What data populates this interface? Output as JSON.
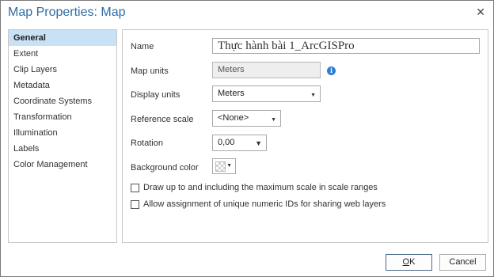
{
  "dialog": {
    "title": "Map Properties: Map",
    "close_glyph": "✕"
  },
  "nav": {
    "items": [
      {
        "label": "General",
        "selected": true
      },
      {
        "label": "Extent"
      },
      {
        "label": "Clip Layers"
      },
      {
        "label": "Metadata"
      },
      {
        "label": "Coordinate Systems"
      },
      {
        "label": "Transformation"
      },
      {
        "label": "Illumination"
      },
      {
        "label": "Labels"
      },
      {
        "label": "Color Management"
      }
    ]
  },
  "general": {
    "name_label": "Name",
    "name_value": "Thực hành bài 1_ArcGISPro",
    "map_units_label": "Map units",
    "map_units_value": "Meters",
    "info_glyph": "i",
    "display_units_label": "Display units",
    "display_units_value": "Meters",
    "reference_scale_label": "Reference scale",
    "reference_scale_value": "<None>",
    "rotation_label": "Rotation",
    "rotation_value": "0,00",
    "background_color_label": "Background color",
    "checkbox_max_scale": {
      "label": "Draw up to and including the maximum scale in scale ranges",
      "checked": false
    },
    "checkbox_unique_ids": {
      "label": "Allow assignment of unique numeric IDs for sharing web layers",
      "checked": false
    }
  },
  "buttons": {
    "ok_mnemonic": "O",
    "ok_rest": "K",
    "cancel": "Cancel"
  },
  "glyphs": {
    "caret_small": "▼",
    "caret_large": "▼"
  },
  "colors": {
    "title": "#2e6da4",
    "selected_nav": "#c9e1f5",
    "info": "#2a7fd4"
  }
}
